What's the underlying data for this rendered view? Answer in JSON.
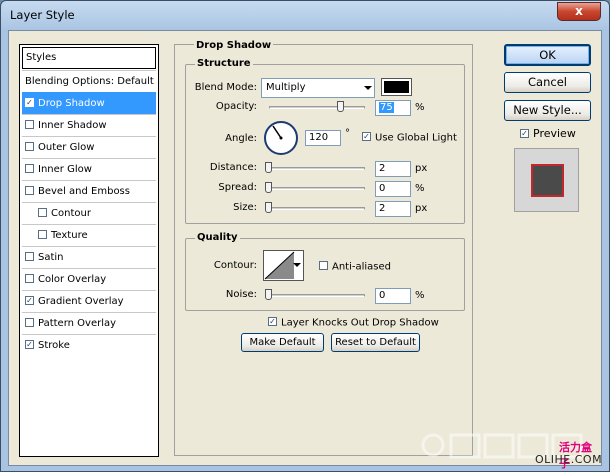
{
  "window": {
    "title": "Layer Style",
    "close_label": "x"
  },
  "styles_list": {
    "header": "Styles",
    "blending_options": "Blending Options: Default",
    "items": [
      {
        "label": "Drop Shadow",
        "checked": true,
        "selected": true,
        "indent": false
      },
      {
        "label": "Inner Shadow",
        "checked": false,
        "selected": false,
        "indent": false
      },
      {
        "label": "Outer Glow",
        "checked": false,
        "selected": false,
        "indent": false
      },
      {
        "label": "Inner Glow",
        "checked": false,
        "selected": false,
        "indent": false
      },
      {
        "label": "Bevel and Emboss",
        "checked": false,
        "selected": false,
        "indent": false
      },
      {
        "label": "Contour",
        "checked": false,
        "selected": false,
        "indent": true
      },
      {
        "label": "Texture",
        "checked": false,
        "selected": false,
        "indent": true
      },
      {
        "label": "Satin",
        "checked": false,
        "selected": false,
        "indent": false
      },
      {
        "label": "Color Overlay",
        "checked": false,
        "selected": false,
        "indent": false
      },
      {
        "label": "Gradient Overlay",
        "checked": true,
        "selected": false,
        "indent": false
      },
      {
        "label": "Pattern Overlay",
        "checked": false,
        "selected": false,
        "indent": false
      },
      {
        "label": "Stroke",
        "checked": true,
        "selected": false,
        "indent": false
      }
    ]
  },
  "drop_shadow": {
    "title": "Drop Shadow",
    "structure": {
      "title": "Structure",
      "blend_mode_label": "Blend Mode:",
      "blend_mode_value": "Multiply",
      "shadow_color": "#000000",
      "opacity_label": "Opacity:",
      "opacity_value": "75",
      "opacity_unit": "%",
      "opacity_level": 0.75,
      "angle_label": "Angle:",
      "angle_value": "120",
      "angle_unit": "°",
      "use_global_light_label": "Use Global Light",
      "use_global_light": true,
      "distance_label": "Distance:",
      "distance_value": "2",
      "distance_unit": "px",
      "spread_label": "Spread:",
      "spread_value": "0",
      "spread_unit": "%",
      "size_label": "Size:",
      "size_value": "2",
      "size_unit": "px"
    },
    "quality": {
      "title": "Quality",
      "contour_label": "Contour:",
      "anti_aliased_label": "Anti-aliased",
      "anti_aliased": false,
      "noise_label": "Noise:",
      "noise_value": "0",
      "noise_unit": "%"
    },
    "knocks_out_label": "Layer Knocks Out Drop Shadow",
    "knocks_out": true,
    "make_default_label": "Make Default",
    "reset_default_label": "Reset to Default"
  },
  "buttons": {
    "ok_label": "OK",
    "cancel_label": "Cancel",
    "new_style_label": "New Style...",
    "preview_label": "Preview",
    "preview_checked": true
  },
  "watermark": {
    "text": "OLIHE.COM",
    "brand": "活力盒子"
  },
  "colors": {
    "selection": "#3399ff",
    "dialog_bg": "#ece9d8",
    "preview_fill": "#4a4a4a",
    "preview_stroke": "#c0282c"
  }
}
